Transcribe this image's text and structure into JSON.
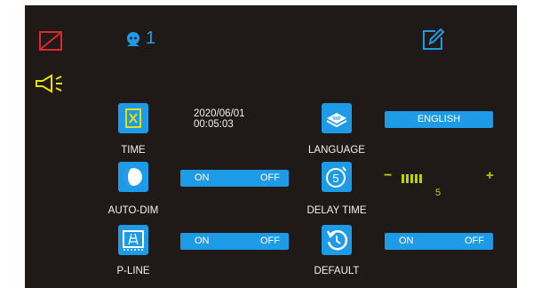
{
  "status": {
    "user_count": "1"
  },
  "settings": {
    "time": {
      "label": "TIME",
      "date": "2020/06/01",
      "clock": "00:05:03"
    },
    "auto_dim": {
      "label": "AUTO-DIM",
      "on_label": "ON",
      "off_label": "OFF"
    },
    "p_line": {
      "label": "P-LINE",
      "on_label": "ON",
      "off_label": "OFF"
    },
    "language": {
      "label": "LANGUAGE",
      "value": "ENGLISH"
    },
    "delay_time": {
      "label": "DELAY TIME",
      "value": "5",
      "minus": "−",
      "plus": "+",
      "level_bars": 5
    },
    "default": {
      "label": "DEFAULT",
      "on_label": "ON",
      "off_label": "OFF"
    }
  },
  "icons": {
    "top_left": "no-camera-icon",
    "mute": "speaker-icon",
    "user": "user-icon",
    "edit": "edit-icon"
  },
  "colors": {
    "background": "#1f1a17",
    "accent": "#1e9be6",
    "alert": "#e0262b",
    "warning": "#e8e000",
    "level": "#b7d400"
  }
}
